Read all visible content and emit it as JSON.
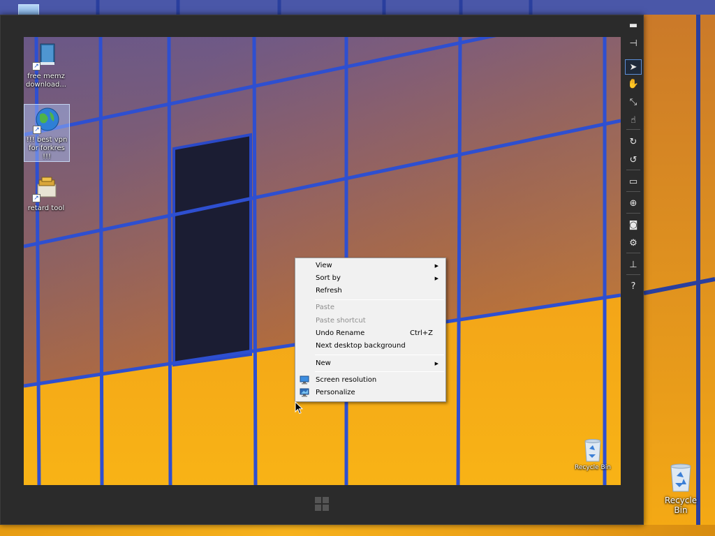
{
  "outer_desktop": {
    "recycle_bin_label": "Recycle Bin"
  },
  "remote_desktop": {
    "icons": [
      {
        "label_line1": "free memz",
        "label_line2": "download...",
        "icon": "book-shortcut-icon"
      },
      {
        "label_line1": "!!! best vpn",
        "label_line2": "for forkres !!!",
        "icon": "globe-shortcut-icon",
        "selected": true
      },
      {
        "label_line1": "retard tool",
        "label_line2": "",
        "icon": "installer-shortcut-icon"
      }
    ],
    "recycle_bin_label": "Recycle Bin"
  },
  "toolbar": {
    "buttons": [
      {
        "name": "minimize",
        "glyph": "▬"
      },
      {
        "name": "pin",
        "glyph": "⊣"
      },
      {
        "name": "pointer",
        "glyph": "➤",
        "active": true
      },
      {
        "name": "hand",
        "glyph": "✋"
      },
      {
        "name": "resize",
        "glyph": "⤡"
      },
      {
        "name": "touch",
        "glyph": "☝"
      },
      {
        "name": "rotate-cw",
        "glyph": "↻"
      },
      {
        "name": "rotate-ccw",
        "glyph": "↺"
      },
      {
        "name": "monitor",
        "glyph": "▭"
      },
      {
        "name": "globe",
        "glyph": "⊕"
      },
      {
        "name": "camera",
        "glyph": "◙"
      },
      {
        "name": "settings",
        "glyph": "⚙"
      },
      {
        "name": "network",
        "glyph": "⊥"
      },
      {
        "name": "help",
        "glyph": "?"
      }
    ]
  },
  "context_menu": {
    "view": "View",
    "sort_by": "Sort by",
    "refresh": "Refresh",
    "paste": "Paste",
    "paste_shortcut": "Paste shortcut",
    "undo_rename": "Undo Rename",
    "undo_rename_shortcut": "Ctrl+Z",
    "next_background": "Next desktop background",
    "new": "New",
    "screen_resolution": "Screen resolution",
    "personalize": "Personalize"
  },
  "colors": {
    "window_frame": "#2b2b2b",
    "menu_bg": "#f1f1f1",
    "disabled_text": "#8d8d8d",
    "toolbar_active_border": "#5d8fd8"
  }
}
